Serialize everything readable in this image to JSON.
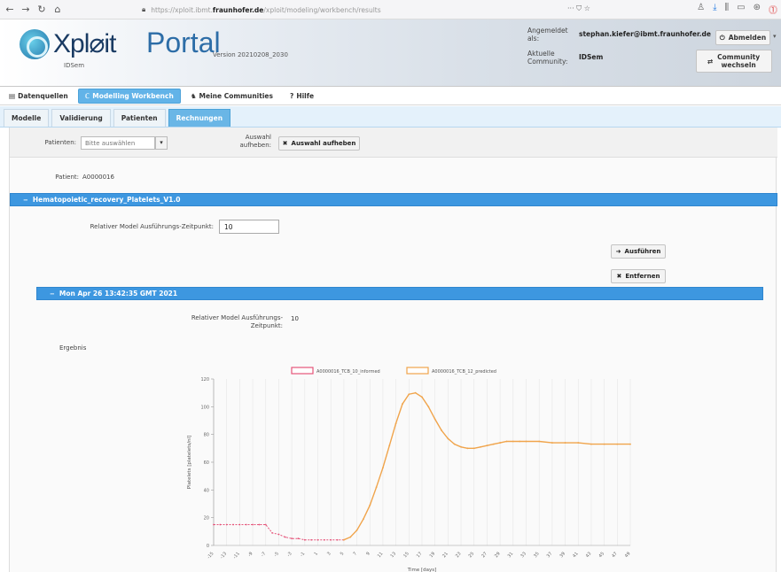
{
  "browser": {
    "url_prefix": "https://xploit.ibmt.",
    "url_domain": "fraunhofer.de",
    "url_suffix": "/xploit/modeling/workbench/results",
    "page_actions": "··· ⛉ ☆"
  },
  "header": {
    "logo_text": "Xpl⌀it",
    "logo_sub": "IDSem",
    "portal_title": "Portal",
    "version": "Version 20210208_2030",
    "logged_in_label": "Angemeldet als:",
    "logged_in_value": "stephan.kiefer@ibmt.fraunhofer.de",
    "community_label": "Aktuelle Community:",
    "community_value": "IDSem",
    "logout_label": "Abmelden",
    "community_switch_label": "Community wechseln"
  },
  "menu": {
    "items": [
      {
        "icon": "▤",
        "label": "Datenquellen"
      },
      {
        "icon": "ℂ",
        "label": "Modelling Workbench"
      },
      {
        "icon": "♞",
        "label": "Meine Communities"
      },
      {
        "icon": "?",
        "label": "Hilfe"
      }
    ]
  },
  "tabs": [
    "Modelle",
    "Validierung",
    "Patienten",
    "Rechnungen"
  ],
  "filter": {
    "patient_label": "Patienten:",
    "patient_placeholder": "Bitte auswählen",
    "clear_label": "Auswahl aufheben:",
    "clear_button": "Auswahl aufheben"
  },
  "patient": {
    "label": "Patient:",
    "value": "A0000016"
  },
  "model_section": {
    "title": "Hematopoietic_recovery_Platelets_V1.0",
    "time_label": "Relativer Model Ausführungs-Zeitpunkt:",
    "time_value": "10",
    "run_button": "Ausführen",
    "remove_button": "Entfernen"
  },
  "result_section": {
    "title": "Mon Apr 26 13:42:35 GMT 2021",
    "time_label": "Relativer Model Ausführungs-Zeitpunkt:",
    "time_value": "10",
    "result_label": "Ergebnis"
  },
  "colors": {
    "accent": "#3d97e0",
    "observed": "#e5557a",
    "predicted": "#f0a44b"
  },
  "chart_data": {
    "type": "line",
    "title": "Hematopoietic_recovery_Platelets_V1.0",
    "xlabel": "Time [days]",
    "ylabel": "Platelets [platelets/nl]",
    "ylim": [
      0,
      120
    ],
    "xlim": [
      -15,
      49
    ],
    "yticks": [
      0,
      20,
      40,
      60,
      80,
      100,
      120
    ],
    "xticks": [
      -15,
      -13,
      -11,
      -9,
      -7,
      -5,
      -3,
      -1,
      1,
      3,
      5,
      7,
      9,
      11,
      13,
      15,
      17,
      19,
      21,
      23,
      25,
      27,
      29,
      31,
      33,
      35,
      37,
      39,
      41,
      43,
      45,
      47,
      49
    ],
    "grid": "vertical",
    "legend_position": "top",
    "series": [
      {
        "name": "A0000016_TCB_10_informed",
        "color": "#e5557a",
        "style": "dashed",
        "x": [
          -15,
          -14,
          -13,
          -12,
          -11,
          -10,
          -9,
          -8,
          -7,
          -6,
          -5,
          -4,
          -3,
          -2,
          -1,
          0,
          1,
          2,
          3,
          4,
          5
        ],
        "y": [
          15,
          15,
          15,
          15,
          15,
          15,
          15,
          15,
          15,
          9,
          8,
          6,
          5,
          5,
          4,
          4,
          4,
          4,
          4,
          4,
          4
        ]
      },
      {
        "name": "A0000016_TCB_12_predicted",
        "color": "#f0a44b",
        "style": "solid",
        "x": [
          5,
          6,
          7,
          8,
          9,
          10,
          11,
          12,
          13,
          14,
          15,
          16,
          17,
          18,
          19,
          20,
          21,
          22,
          23,
          24,
          25,
          26,
          27,
          28,
          29,
          30,
          31,
          32,
          33,
          35,
          37,
          39,
          41,
          43,
          45,
          47,
          49
        ],
        "y": [
          4,
          6,
          11,
          19,
          29,
          42,
          56,
          72,
          88,
          102,
          109,
          110,
          107,
          100,
          91,
          83,
          77,
          73,
          71,
          70,
          70,
          71,
          72,
          73,
          74,
          75,
          75,
          75,
          75,
          75,
          74,
          74,
          74,
          73,
          73,
          73,
          73
        ]
      }
    ]
  }
}
